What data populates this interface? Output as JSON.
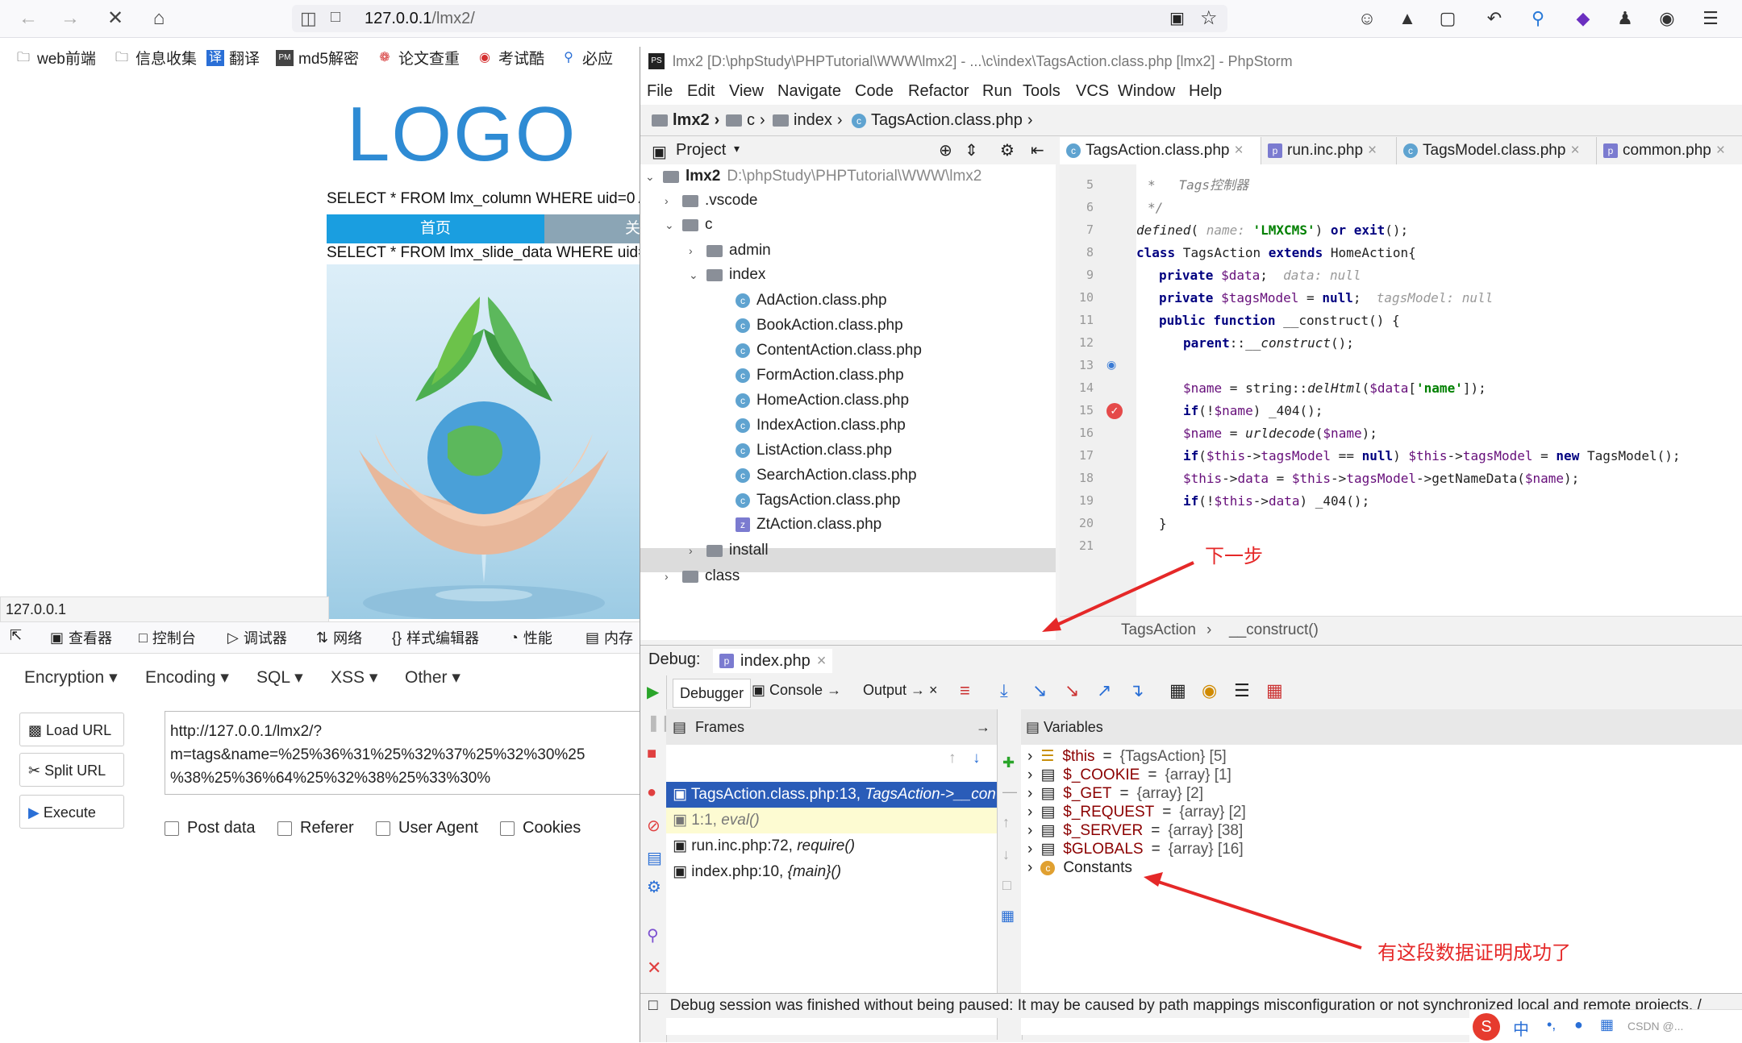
{
  "browser": {
    "url_host": "127.0.0.1",
    "url_path": "/lmx2/",
    "bookmarks": [
      "web前端",
      "信息收集",
      "翻译",
      "md5解密",
      "论文查重",
      "考试酷",
      "必应"
    ],
    "status_url": "127.0.0.1"
  },
  "page": {
    "logo": "LOGO",
    "sql1": "SELECT * FROM lmx_column WHERE uid=0 A",
    "sql2": "SELECT * FROM lmx_slide_data WHERE uid=1",
    "nav_active": "首页",
    "nav_next": "关"
  },
  "devtools": {
    "tabs": [
      "查看器",
      "控制台",
      "调试器",
      "网络",
      "样式编辑器",
      "性能",
      "内存"
    ]
  },
  "hackbar": {
    "menus": [
      "Encryption",
      "Encoding",
      "SQL",
      "XSS",
      "Other"
    ],
    "load_url": "Load URL",
    "split_url": "Split URL",
    "execute": "Execute",
    "url_line1": "http://127.0.0.1/lmx2/?",
    "url_line2": "m=tags&name=%25%36%31%25%32%37%25%32%30%25",
    "url_line3": "%38%25%36%64%25%32%38%25%33%30%",
    "checks": [
      "Post data",
      "Referer",
      "User Agent",
      "Cookies"
    ]
  },
  "phpstorm": {
    "title": "lmx2 [D:\\phpStudy\\PHPTutorial\\WWW\\lmx2] - ...\\c\\index\\TagsAction.class.php [lmx2] - PhpStorm",
    "menu": [
      "File",
      "Edit",
      "View",
      "Navigate",
      "Code",
      "Refactor",
      "Run",
      "Tools",
      "VCS",
      "Window",
      "Help"
    ],
    "nav": [
      "lmx2",
      "c",
      "index",
      "TagsAction.class.php"
    ],
    "project_label": "Project",
    "tree": {
      "root": "lmx2",
      "root_path": "D:\\phpStudy\\PHPTutorial\\WWW\\lmx2",
      "items": [
        ".vscode",
        "c",
        "admin",
        "index",
        "AdAction.class.php",
        "BookAction.class.php",
        "ContentAction.class.php",
        "FormAction.class.php",
        "HomeAction.class.php",
        "IndexAction.class.php",
        "ListAction.class.php",
        "SearchAction.class.php",
        "TagsAction.class.php",
        "ZtAction.class.php",
        "install",
        "class"
      ]
    },
    "editor_tabs": [
      "TagsAction.class.php",
      "run.inc.php",
      "TagsModel.class.php",
      "common.php"
    ],
    "line_numbers": [
      "5",
      "6",
      "7",
      "8",
      "9",
      "10",
      "11",
      "12",
      "13",
      "14",
      "15",
      "16",
      "17",
      "18",
      "19",
      "20",
      "21"
    ],
    "breadcrumb": [
      "TagsAction",
      "__construct()"
    ],
    "debug": {
      "label": "Debug:",
      "tab": "index.php",
      "subtabs": [
        "Debugger",
        "Console",
        "Output"
      ],
      "frames_label": "Frames",
      "variables_label": "Variables",
      "frames": [
        {
          "file": "TagsAction.class.php:13,",
          "fn": "TagsAction->__con"
        },
        {
          "file": "1:1,",
          "fn": "eval()"
        },
        {
          "file": "run.inc.php:72,",
          "fn": "require()"
        },
        {
          "file": "index.php:10,",
          "fn": "{main}()"
        }
      ],
      "variables": [
        {
          "name": "$this",
          "val": "{TagsAction} [5]"
        },
        {
          "name": "$_COOKIE",
          "val": "{array} [1]"
        },
        {
          "name": "$_GET",
          "val": "{array} [2]"
        },
        {
          "name": "$_REQUEST",
          "val": "{array} [2]"
        },
        {
          "name": "$_SERVER",
          "val": "{array} [38]"
        },
        {
          "name": "$GLOBALS",
          "val": "{array} [16]"
        },
        {
          "name": "Constants",
          "val": ""
        }
      ],
      "status": "Debug session was finished without being paused: It may be caused by path mappings misconfiguration or not synchronized local and remote projects. /"
    }
  },
  "annotations": {
    "next_step": "下一步",
    "proof": "有这段数据证明成功了"
  },
  "ime": {
    "text": "中",
    "watermark": "CSDN @..."
  }
}
